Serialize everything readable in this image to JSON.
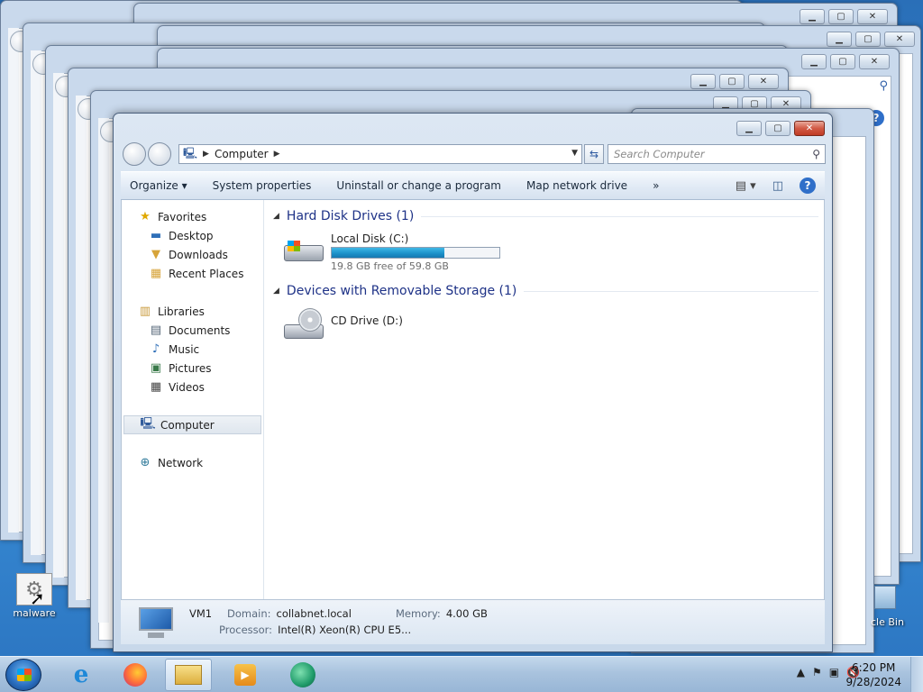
{
  "window": {
    "address_crumb": "Computer",
    "search_placeholder": "Search Computer"
  },
  "toolbar": {
    "organize": "Organize ▾",
    "system_properties": "System properties",
    "uninstall": "Uninstall or change a program",
    "map_drive": "Map network drive",
    "more": "»"
  },
  "nav_pane": {
    "favorites": "Favorites",
    "desktop": "Desktop",
    "downloads": "Downloads",
    "recent_places": "Recent Places",
    "libraries": "Libraries",
    "documents": "Documents",
    "music": "Music",
    "pictures": "Pictures",
    "videos": "Videos",
    "computer": "Computer",
    "network": "Network"
  },
  "groups": {
    "hard_disk": "Hard Disk Drives (1)",
    "removable": "Devices with Removable Storage (1)"
  },
  "drives": {
    "local_disk": {
      "name": "Local Disk (C:)",
      "free_text": "19.8 GB free of 59.8 GB",
      "used_fraction": 0.67
    },
    "cd_drive": {
      "name": "CD Drive (D:)"
    }
  },
  "details": {
    "computer_name": "VM1",
    "domain_label": "Domain:",
    "domain_value": "collabnet.local",
    "memory_label": "Memory:",
    "memory_value": "4.00 GB",
    "processor_label": "Processor:",
    "processor_value": "Intel(R) Xeon(R) CPU E5..."
  },
  "desktop": {
    "malware_label": "malware",
    "recycle_label": "cle Bin"
  },
  "clock": {
    "time": "6:20 PM",
    "date": "9/28/2024"
  },
  "colors": {
    "progress": "#1b8fc8",
    "close_button": "#c94b35"
  }
}
